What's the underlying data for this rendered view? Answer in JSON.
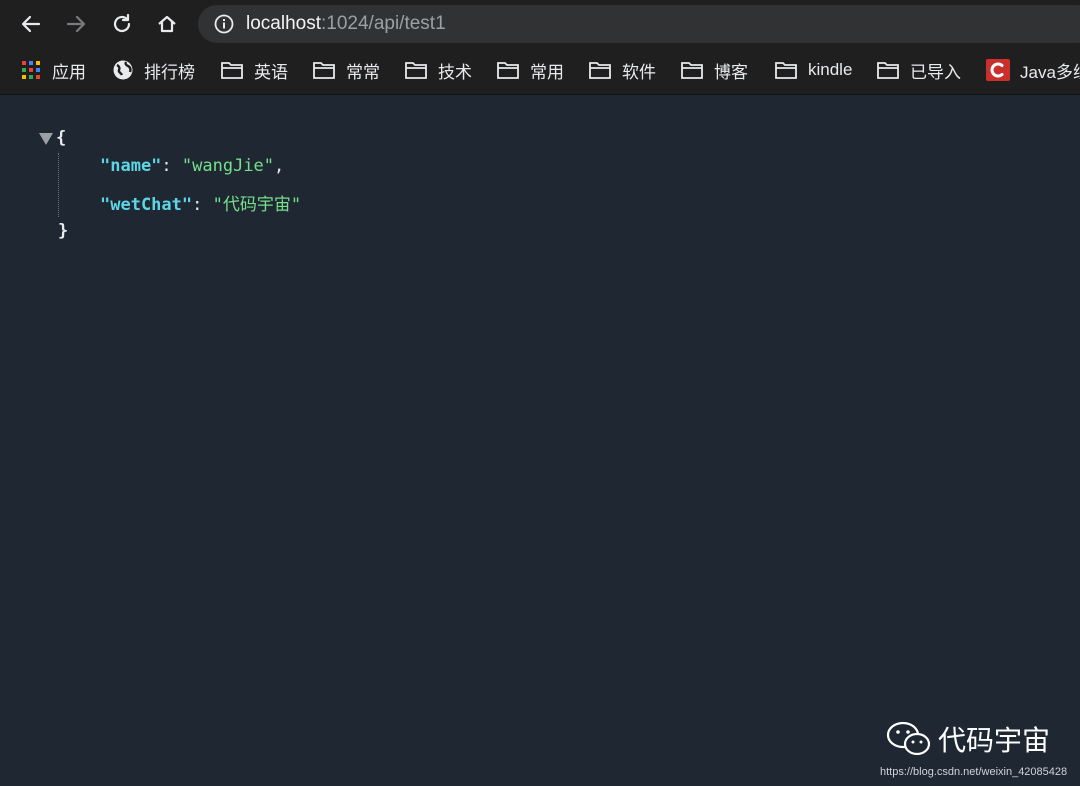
{
  "browser": {
    "url_host": "localhost",
    "url_rest": ":1024/api/test1"
  },
  "bookmarks": [
    {
      "label": "应用",
      "icon": "apps-grid-icon"
    },
    {
      "label": "排行榜",
      "icon": "globe-icon"
    },
    {
      "label": "英语",
      "icon": "folder-icon"
    },
    {
      "label": "常常",
      "icon": "folder-icon"
    },
    {
      "label": "技术",
      "icon": "folder-icon"
    },
    {
      "label": "常用",
      "icon": "folder-icon"
    },
    {
      "label": "软件",
      "icon": "folder-icon"
    },
    {
      "label": "博客",
      "icon": "folder-icon"
    },
    {
      "label": "kindle",
      "icon": "folder-icon"
    },
    {
      "label": "已导入",
      "icon": "folder-icon"
    },
    {
      "label": "Java多线",
      "icon": "csdn-icon"
    }
  ],
  "json": {
    "open_brace": "{",
    "close_brace": "}",
    "entries": [
      {
        "key": "\"name\"",
        "value": "\"wangJie\"",
        "trailing": ","
      },
      {
        "key": "\"wetChat\"",
        "value": "\"代码宇宙\"",
        "trailing": ""
      }
    ],
    "separator": ": "
  },
  "watermark": {
    "label": "代码宇宙",
    "url": "https://blog.csdn.net/weixin_42085428"
  },
  "colors": {
    "page_bg": "#1e2732",
    "key": "#5cd6e6",
    "string": "#74e08a"
  }
}
